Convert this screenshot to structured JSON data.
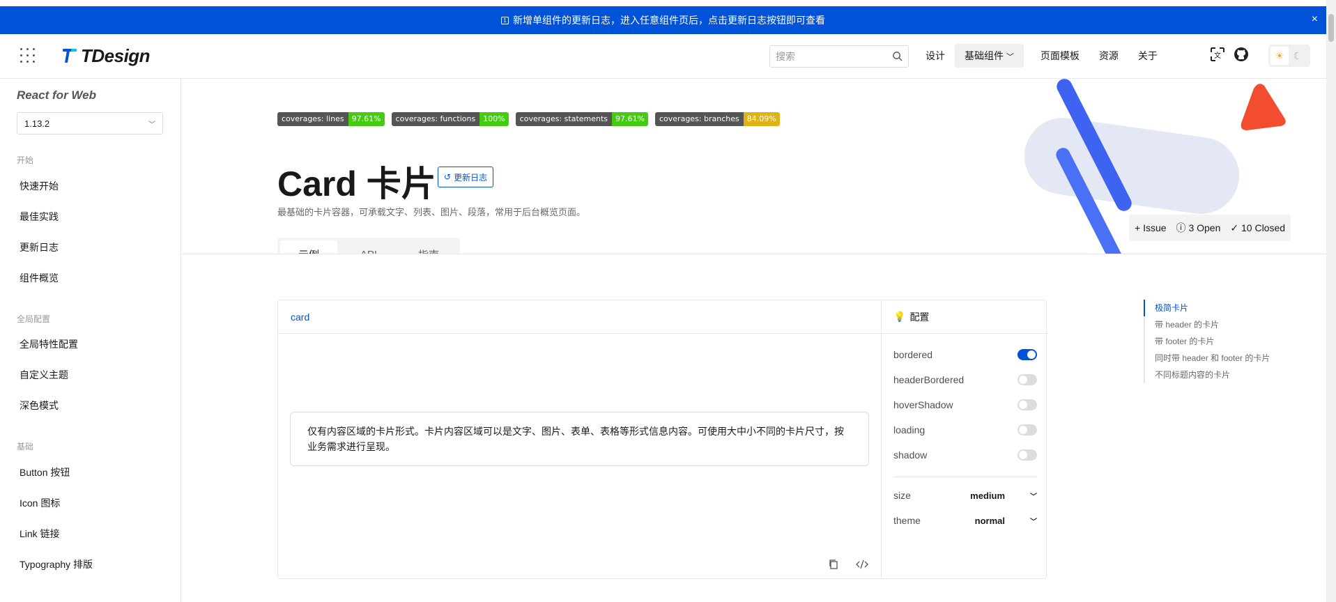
{
  "banner": {
    "text": "新增单组件的更新日志，进入任意组件页后，点击更新日志按钮即可查看",
    "close": "×"
  },
  "header": {
    "logo": "TDesign",
    "search_placeholder": "搜索",
    "nav": [
      "设计",
      "基础组件",
      "页面模板",
      "资源",
      "关于"
    ],
    "theme": {
      "light": "☀",
      "dark": "☾"
    }
  },
  "sidebar": {
    "title": "React for Web",
    "version": "1.13.2",
    "groups": [
      {
        "label": "开始",
        "items": [
          "快速开始",
          "最佳实践",
          "更新日志",
          "组件概览"
        ]
      },
      {
        "label": "全局配置",
        "items": [
          "全局特性配置",
          "自定义主题",
          "深色模式"
        ]
      },
      {
        "label": "基础",
        "items": [
          "Button 按钮",
          "Icon 图标",
          "Link 链接",
          "Typography 排版"
        ]
      }
    ]
  },
  "badges": [
    {
      "label": "coverages: lines",
      "value": "97.61%",
      "color": "#4c1"
    },
    {
      "label": "coverages: functions",
      "value": "100%",
      "color": "#4c1"
    },
    {
      "label": "coverages: statements",
      "value": "97.61%",
      "color": "#4c1"
    },
    {
      "label": "coverages: branches",
      "value": "84.09%",
      "color": "#dfb317"
    }
  ],
  "page": {
    "title": "Card 卡片",
    "changelog_button": "更新日志",
    "description": "最基础的卡片容器，可承载文字、列表、图片、段落，常用于后台概览页面。",
    "tabs": [
      "示例",
      "API",
      "指南"
    ]
  },
  "issue_bar": {
    "issue": "Issue",
    "open": "3 Open",
    "closed": "10 Closed"
  },
  "demo": {
    "tab": "card",
    "card_text": "仅有内容区域的卡片形式。卡片内容区域可以是文字、图片、表单、表格等形式信息内容。可使用大中小不同的卡片尺寸，按业务需求进行呈现。",
    "config_title": "配置",
    "switches": [
      {
        "label": "bordered",
        "on": true
      },
      {
        "label": "headerBordered",
        "on": false
      },
      {
        "label": "hoverShadow",
        "on": false
      },
      {
        "label": "loading",
        "on": false
      },
      {
        "label": "shadow",
        "on": false
      }
    ],
    "selects": [
      {
        "label": "size",
        "value": "medium"
      },
      {
        "label": "theme",
        "value": "normal"
      }
    ]
  },
  "anchors": [
    "极简卡片",
    "带 header 的卡片",
    "带 footer 的卡片",
    "同时带 header 和 footer 的卡片",
    "不同标题内容的卡片"
  ],
  "colors": {
    "brand": "#0052d9",
    "deco_red": "#f24d2e"
  }
}
